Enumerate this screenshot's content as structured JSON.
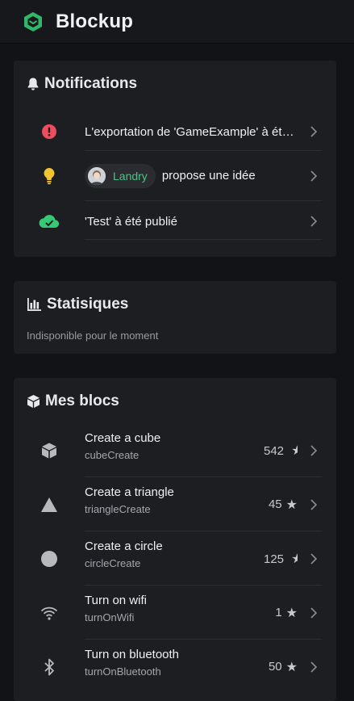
{
  "app": {
    "title": "Blockup",
    "accent": "#2fb86a"
  },
  "notifications": {
    "title": "Notifications",
    "items": [
      {
        "icon": "error-icon",
        "color": "#ef4d5d",
        "text": "L'exportation de 'GameExample' à été terminée"
      },
      {
        "icon": "lightbulb-icon",
        "color": "#f1c232",
        "user": "Landry",
        "text": "propose une idée"
      },
      {
        "icon": "cloud-check-icon",
        "color": "#35c975",
        "text": "'Test' à été publié"
      }
    ]
  },
  "stats": {
    "title": "Statisiques",
    "message": "Indisponible pour le moment"
  },
  "blocks": {
    "title": "Mes blocs",
    "items": [
      {
        "icon": "cube-icon",
        "name": "Create a cube",
        "id": "cubeCreate",
        "stars": "542"
      },
      {
        "icon": "triangle-icon",
        "name": "Create a triangle",
        "id": "triangleCreate",
        "stars": "45"
      },
      {
        "icon": "circle-icon",
        "name": "Create a circle",
        "id": "circleCreate",
        "stars": "125"
      },
      {
        "icon": "wifi-icon",
        "name": "Turn on wifi",
        "id": "turnOnWifi",
        "stars": "1"
      },
      {
        "icon": "bluetooth-icon",
        "name": "Turn on bluetooth",
        "id": "turnOnBluetooth",
        "stars": "50"
      }
    ]
  }
}
